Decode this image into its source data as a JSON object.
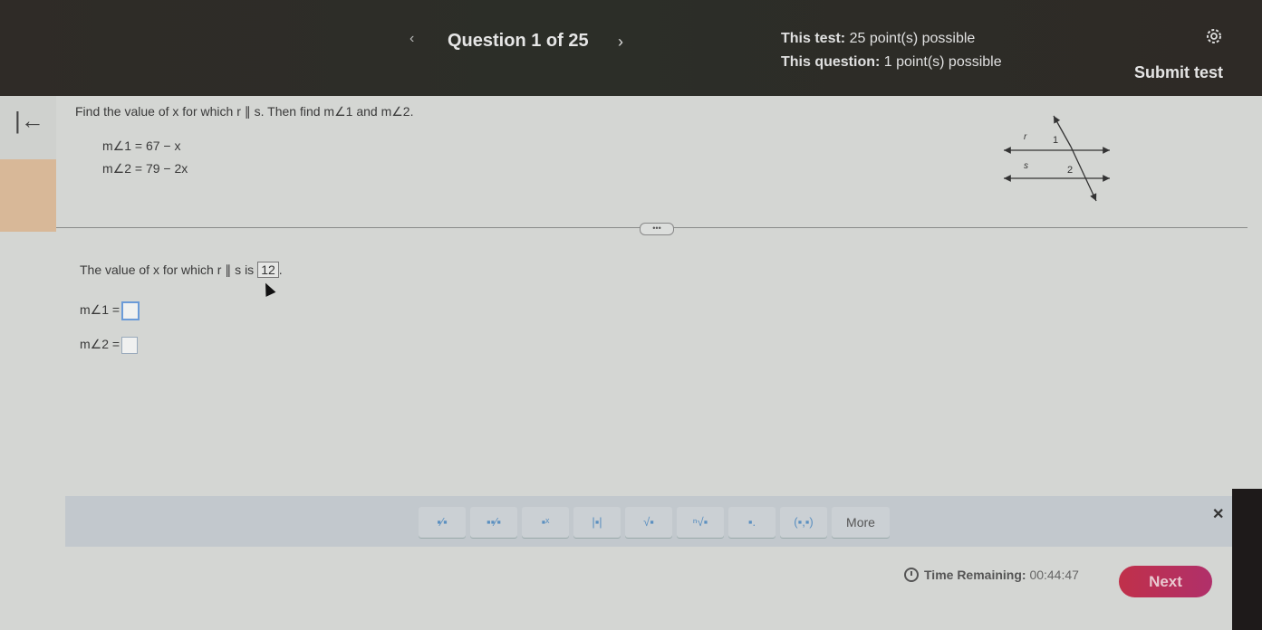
{
  "header": {
    "prev_icon": "chevron-left-icon",
    "title": "Question 1 of 25",
    "next_icon": "chevron-right-icon",
    "test_points_label": "This test:",
    "test_points_value": "25 point(s) possible",
    "question_points_label": "This question:",
    "question_points_value": "1 point(s) possible",
    "settings_icon": "gear-icon",
    "submit_label": "Submit test"
  },
  "sidebar": {
    "collapse_icon": "collapse-left-arrow-icon",
    "collapse_glyph": "|←"
  },
  "question": {
    "prompt": "Find the value of x for which r ∥ s. Then find m∠1 and m∠2.",
    "equations": [
      "m∠1 = 67 − x",
      "m∠2 = 79 − 2x"
    ],
    "diagram": {
      "line_labels": [
        "r",
        "s"
      ],
      "angle_labels": [
        "1",
        "2"
      ]
    }
  },
  "divider": {
    "more_label": "•••"
  },
  "answer": {
    "x_prefix": "The value of x for which r ∥ s is",
    "x_value": "12",
    "x_suffix": ".",
    "angle1_label": "m∠1 =",
    "angle1_value": "",
    "angle2_label": "m∠2 =",
    "angle2_value": ""
  },
  "math_toolbar": {
    "tools": [
      {
        "name": "fraction",
        "glyph": "▪⁄▪"
      },
      {
        "name": "mixed-number",
        "glyph": "▪▪⁄▪"
      },
      {
        "name": "exponent",
        "glyph": "▪ˣ"
      },
      {
        "name": "absolute-value",
        "glyph": "|▪|"
      },
      {
        "name": "square-root",
        "glyph": "√▪"
      },
      {
        "name": "nth-root",
        "glyph": "ⁿ√▪"
      },
      {
        "name": "subscript",
        "glyph": "▪."
      },
      {
        "name": "ordered-pair",
        "glyph": "(▪,▪)"
      }
    ],
    "more_label": "More",
    "close_glyph": "✕"
  },
  "footer": {
    "timer_label": "Time Remaining:",
    "timer_value": "00:44:47",
    "next_label": "Next"
  }
}
